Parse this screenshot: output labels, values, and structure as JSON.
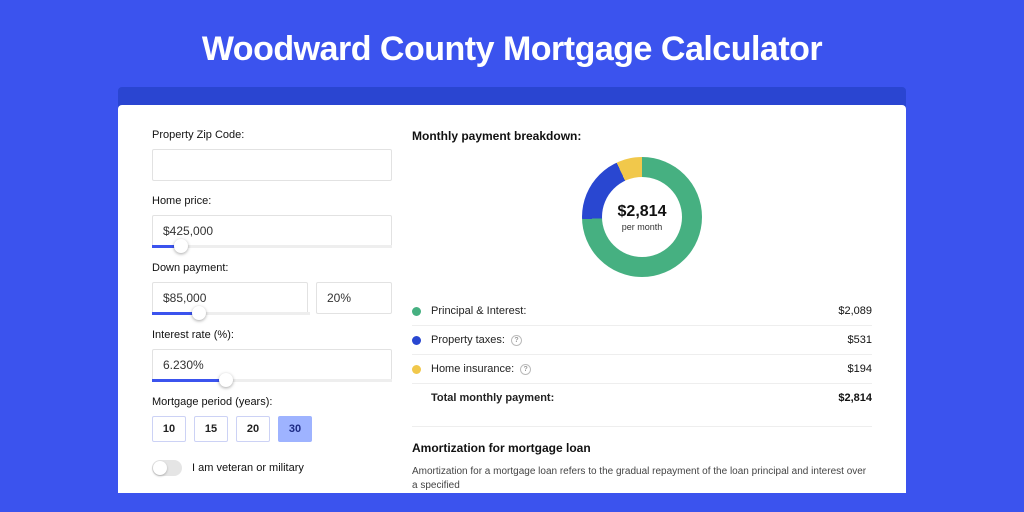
{
  "title": "Woodward County Mortgage Calculator",
  "form": {
    "zip": {
      "label": "Property Zip Code:",
      "value": ""
    },
    "home_price": {
      "label": "Home price:",
      "value": "$425,000"
    },
    "down_payment": {
      "label": "Down payment:",
      "amount": "$85,000",
      "percent": "20%"
    },
    "interest_rate": {
      "label": "Interest rate (%):",
      "value": "6.230%"
    },
    "period": {
      "label": "Mortgage period (years):",
      "options": [
        "10",
        "15",
        "20",
        "30"
      ],
      "selected": "30"
    },
    "veteran": {
      "label": "I am veteran or military",
      "on": false
    }
  },
  "breakdown": {
    "title": "Monthly payment breakdown:",
    "center_amount": "$2,814",
    "center_sub": "per month",
    "rows": [
      {
        "label": "Principal & Interest:",
        "value": "$2,089",
        "color": "#46b081",
        "info": false
      },
      {
        "label": "Property taxes:",
        "value": "$531",
        "color": "#2947d1",
        "info": true
      },
      {
        "label": "Home insurance:",
        "value": "$194",
        "color": "#f1c84b",
        "info": true
      }
    ],
    "total": {
      "label": "Total monthly payment:",
      "value": "$2,814"
    }
  },
  "amort": {
    "title": "Amortization for mortgage loan",
    "text": "Amortization for a mortgage loan refers to the gradual repayment of the loan principal and interest over a specified"
  },
  "colors": {
    "pi": "#46b081",
    "pt": "#2947d1",
    "hi": "#f1c84b"
  },
  "chart_data": {
    "type": "pie",
    "title": "Monthly payment breakdown",
    "series": [
      {
        "name": "Principal & Interest",
        "value": 2089
      },
      {
        "name": "Property taxes",
        "value": 531
      },
      {
        "name": "Home insurance",
        "value": 194
      }
    ],
    "total": 2814,
    "unit": "USD per month"
  }
}
